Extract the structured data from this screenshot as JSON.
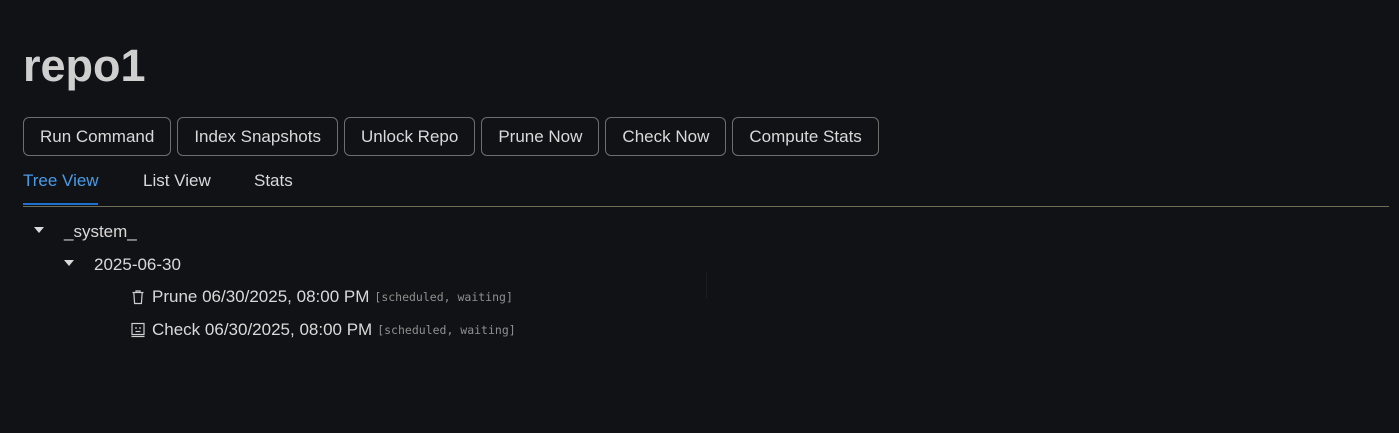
{
  "repo": {
    "title": "repo1"
  },
  "toolbar": {
    "buttons": [
      {
        "label": "Run Command"
      },
      {
        "label": "Index Snapshots"
      },
      {
        "label": "Unlock Repo"
      },
      {
        "label": "Prune Now"
      },
      {
        "label": "Check Now"
      },
      {
        "label": "Compute Stats"
      }
    ]
  },
  "tabs": [
    {
      "label": "Tree View",
      "active": true
    },
    {
      "label": "List View",
      "active": false
    },
    {
      "label": "Stats",
      "active": false
    }
  ],
  "tree": {
    "root": {
      "label": "_system_",
      "expanded": true,
      "children": [
        {
          "label": "2025-06-30",
          "expanded": true,
          "items": [
            {
              "icon": "trash-icon",
              "text": "Prune 06/30/2025, 08:00 PM",
              "status": "[scheduled, waiting]"
            },
            {
              "icon": "check-task-icon",
              "text": "Check 06/30/2025, 08:00 PM",
              "status": "[scheduled, waiting]"
            }
          ]
        }
      ]
    }
  },
  "colors": {
    "background": "#111215",
    "accent": "#4a9be8",
    "text": "#d9d9d9",
    "muted": "#8f8f8f"
  }
}
